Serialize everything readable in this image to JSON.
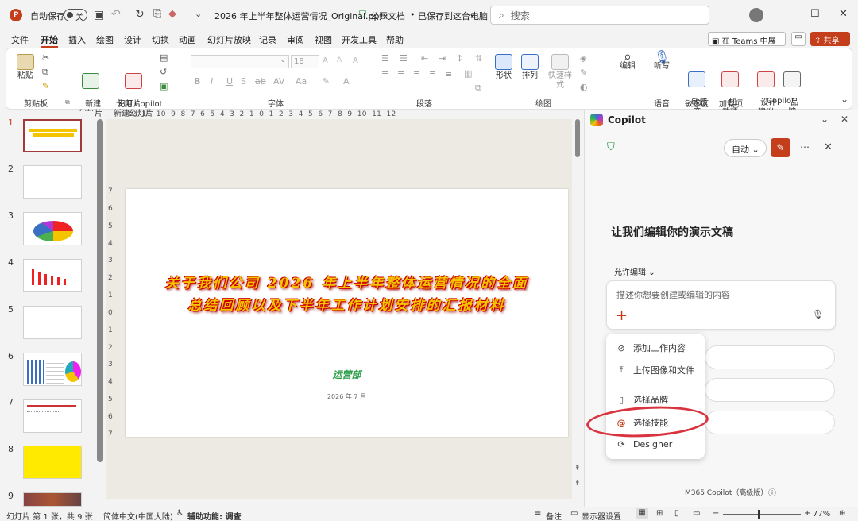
{
  "titlebar": {
    "autosave_label": "自动保存",
    "autosave_state": "关",
    "file_name": "2026 年上半年整体运营情况_Original.pptx",
    "sensitivity": "公开文档",
    "save_status": "已保存到这台电脑",
    "search_placeholder": "搜索"
  },
  "menu": [
    "文件",
    "开始",
    "插入",
    "绘图",
    "设计",
    "切换",
    "动画",
    "幻灯片放映",
    "记录",
    "审阅",
    "视图",
    "开发工具",
    "帮助"
  ],
  "teams_button": "在 Teams 中展示",
  "share_button": "共享",
  "ribbon": {
    "paste": "粘贴",
    "clipboard": "剪贴板",
    "new_slide": "新建\n幻灯片",
    "copilot_new_slide": "使用 Copilot\n新建幻灯片",
    "slides": "幻灯片",
    "font_size": "18",
    "font": "字体",
    "paragraph": "段落",
    "shape": "形状",
    "arrange": "排列",
    "quick_style": "快速样式",
    "drawing": "绘图",
    "edit": "编辑",
    "dictate": "听写",
    "voice": "语音",
    "sensitivity": "敏感\n度",
    "sensitivity_group": "敏感度",
    "addins": "加\n载项",
    "addins_group": "加载项",
    "designer": "设计\n建议",
    "brand": "品\n牌",
    "copilot_group": "Copilot"
  },
  "thumbnails": [
    "1",
    "2",
    "3",
    "4",
    "5",
    "6",
    "7",
    "8",
    "9"
  ],
  "slide": {
    "title_line1": "关于我们公司 2026 年上半年整体运营情况的全面",
    "title_line2": "总结回顾以及下半年工作计划安排的汇报材料",
    "subtitle": "运营部",
    "date": "2026 年 7 月"
  },
  "ruler_h": "12  11  10  9  8  7  6  5  4  3  2  1  0  1  2  3  4  5  6  7  8  9  10  11  12",
  "ruler_v": [
    "7",
    "6",
    "5",
    "4",
    "3",
    "2",
    "1",
    "0",
    "1",
    "2",
    "3",
    "4",
    "5",
    "6",
    "7"
  ],
  "copilot": {
    "title": "Copilot",
    "mode": "自动",
    "heading": "让我们编辑你的演示文稿",
    "permission": "允许编辑",
    "input_placeholder": "描述你想要创建或编辑的内容",
    "menu_items": [
      "添加工作内容",
      "上传图像和文件",
      "选择品牌",
      "选择技能",
      "Designer"
    ],
    "footer": "M365 Copilot（高级版）"
  },
  "status": {
    "slide_info": "幻灯片 第 1 张，共 9 张",
    "language": "简体中文(中国大陆)",
    "accessibility": "辅助功能: 调查",
    "notes": "备注",
    "display": "显示器设置",
    "zoom": "77%"
  },
  "colors": {
    "accent": "#c43e1c",
    "highlight_circle": "#d9333f"
  }
}
